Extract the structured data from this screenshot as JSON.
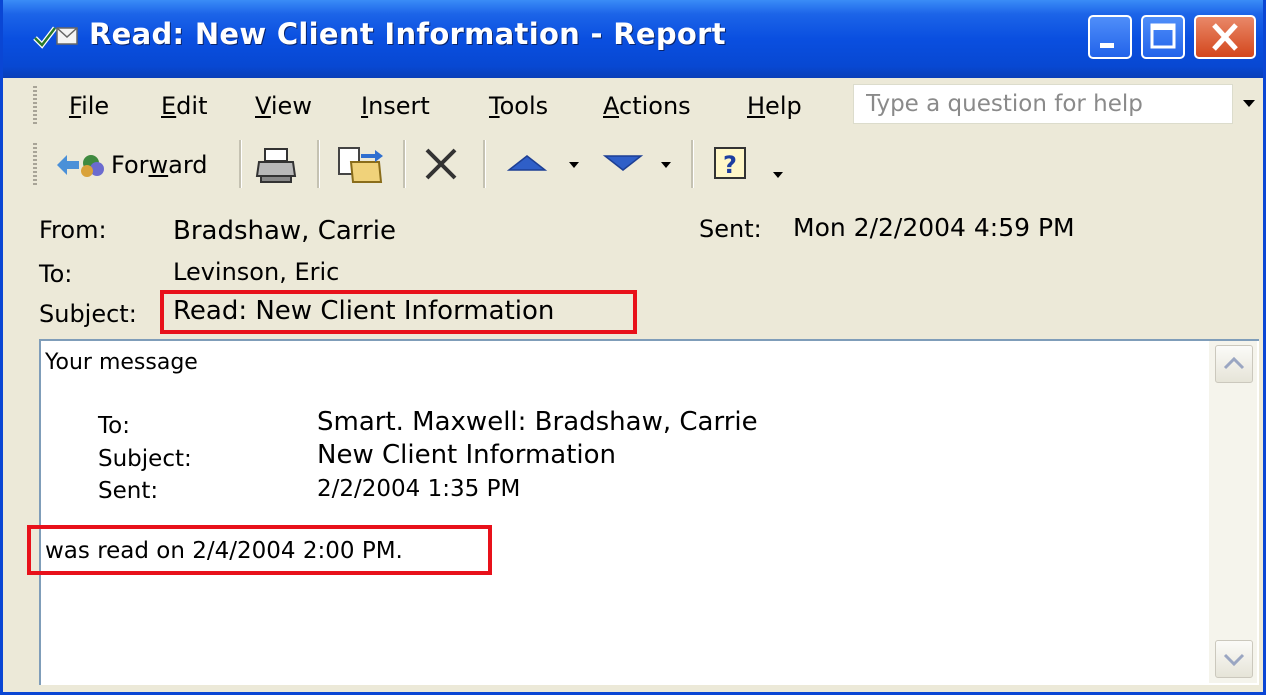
{
  "window": {
    "title": "Read: New Client Information - Report",
    "title_icon": "envelope-check-icon",
    "controls": [
      "minimize-icon",
      "maximize-icon",
      "close-icon"
    ]
  },
  "menu": {
    "items": [
      {
        "pre": "",
        "ul": "F",
        "post": "ile"
      },
      {
        "pre": "",
        "ul": "E",
        "post": "dit"
      },
      {
        "pre": "",
        "ul": "V",
        "post": "iew"
      },
      {
        "pre": "",
        "ul": "I",
        "post": "nsert"
      },
      {
        "pre": "",
        "ul": "T",
        "post": "ools"
      },
      {
        "pre": "",
        "ul": "A",
        "post": "ctions"
      },
      {
        "pre": "",
        "ul": "H",
        "post": "elp"
      }
    ],
    "help_placeholder": "Type a question for help"
  },
  "toolbar": {
    "forward": {
      "pre": "For",
      "ul": "w",
      "post": "ard"
    },
    "icons": [
      "forward-icon",
      "print-icon",
      "move-to-folder-icon",
      "delete-icon",
      "previous-item-icon",
      "next-item-icon",
      "help-icon"
    ]
  },
  "header": {
    "from_label": "From:",
    "from_value": "Bradshaw, Carrie",
    "sent_label": "Sent:",
    "sent_value": "Mon 2/2/2004 4:59 PM",
    "to_label": "To:",
    "to_value": "Levinson, Eric",
    "subject_label": "Subject:",
    "subject_value": "Read: New Client Information"
  },
  "message": {
    "intro": "Your message",
    "to_label": "To:",
    "to_value": "Smart. Maxwell: Bradshaw, Carrie",
    "subject_label": "Subject:",
    "subject_value": "New Client Information",
    "sent_label": "Sent:",
    "sent_value": "2/2/2004 1:35 PM",
    "read_line": "was read on 2/4/2004 2:00 PM."
  },
  "colors": {
    "titlebar": "#0a4fe0",
    "highlight": "#e8111a",
    "chrome": "#ece9d8"
  }
}
